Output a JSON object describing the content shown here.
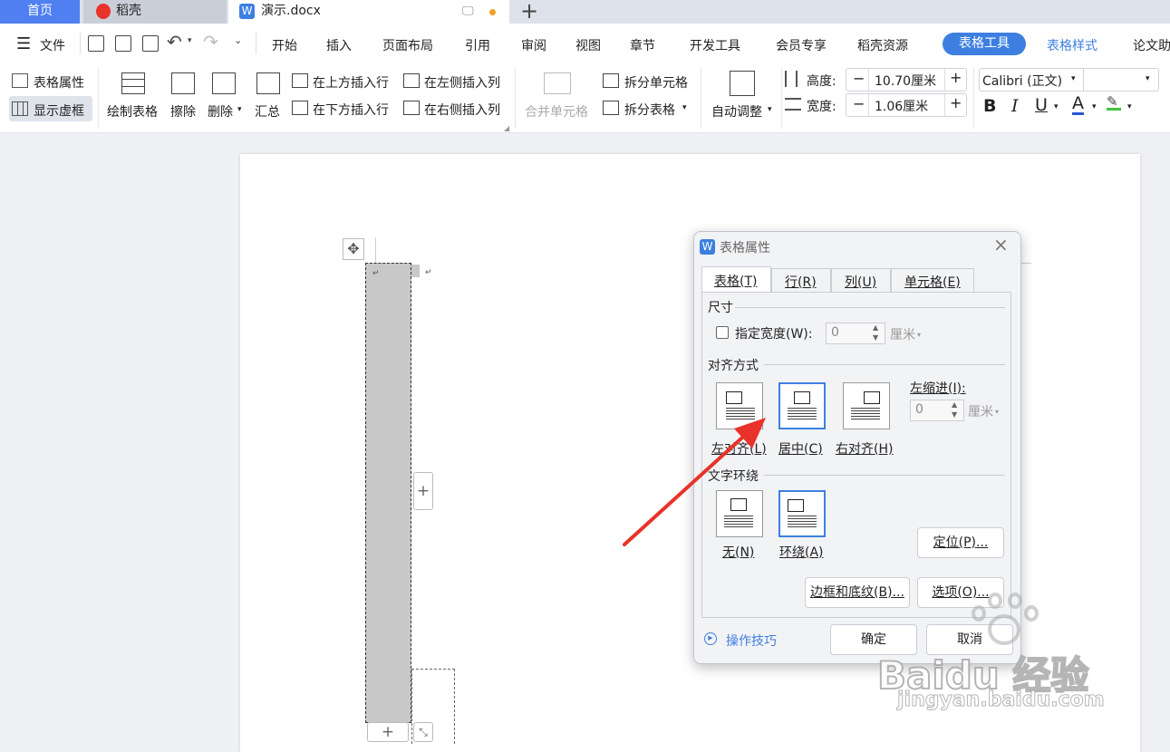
{
  "tabs": {
    "home": "首页",
    "daoke": "稻壳",
    "doc": "演示.docx"
  },
  "menubar": {
    "file": "文件",
    "items": [
      "开始",
      "插入",
      "页面布局",
      "引用",
      "审阅",
      "视图",
      "章节",
      "开发工具",
      "会员专享",
      "稻壳资源"
    ],
    "active": "表格工具",
    "table_style": "表格样式",
    "more": "论文助"
  },
  "ribbon": {
    "table_props": "表格属性",
    "show_grid": "显示虚框",
    "draw_table": "绘制表格",
    "erase": "擦除",
    "delete": "删除",
    "summary": "汇总",
    "insert_above": "在上方插入行",
    "insert_below": "在下方插入行",
    "insert_left": "在左侧插入列",
    "insert_right": "在右侧插入列",
    "merge_cells": "合并单元格",
    "split_cells": "拆分单元格",
    "split_table": "拆分表格",
    "auto_adjust": "自动调整",
    "height_label": "高度:",
    "height_value": "10.70厘米",
    "width_label": "宽度:",
    "width_value": "1.06厘米",
    "font_name": "Calibri (正文)",
    "bold": "B",
    "italic": "I",
    "underline": "U",
    "font_color": "A"
  },
  "dialog": {
    "title": "表格属性",
    "tabs": [
      "表格(T)",
      "行(R)",
      "列(U)",
      "单元格(E)"
    ],
    "size_section": "尺寸",
    "specify_width": "指定宽度(W):",
    "width_value": "0",
    "width_unit": "厘米",
    "align_section": "对齐方式",
    "align_left": "左对齐(L)",
    "align_center": "居中(C)",
    "align_right": "右对齐(H)",
    "left_indent": "左缩进(I):",
    "indent_value": "0",
    "indent_unit": "厘米",
    "wrap_section": "文字环绕",
    "wrap_none": "无(N)",
    "wrap_around": "环绕(A)",
    "position_btn": "定位(P)...",
    "borders_btn": "边框和底纹(B)...",
    "options_btn": "选项(O)...",
    "tips": "操作技巧",
    "ok": "确定",
    "cancel": "取消"
  },
  "watermark": {
    "logo": "Baidu 经验",
    "url": "jingyan.baidu.com"
  },
  "colors": {
    "accent": "#3d7fe0",
    "home_tab": "#4f7ff0",
    "arrow": "#e8322a"
  }
}
